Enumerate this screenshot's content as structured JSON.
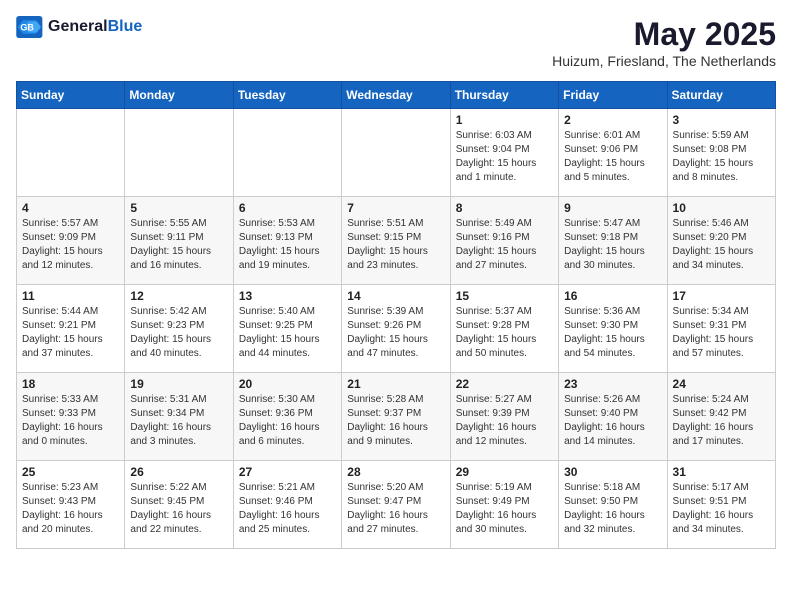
{
  "header": {
    "logo_general": "General",
    "logo_blue": "Blue",
    "month": "May 2025",
    "location": "Huizum, Friesland, The Netherlands"
  },
  "weekdays": [
    "Sunday",
    "Monday",
    "Tuesday",
    "Wednesday",
    "Thursday",
    "Friday",
    "Saturday"
  ],
  "weeks": [
    [
      {
        "day": "",
        "text": ""
      },
      {
        "day": "",
        "text": ""
      },
      {
        "day": "",
        "text": ""
      },
      {
        "day": "",
        "text": ""
      },
      {
        "day": "1",
        "text": "Sunrise: 6:03 AM\nSunset: 9:04 PM\nDaylight: 15 hours\nand 1 minute."
      },
      {
        "day": "2",
        "text": "Sunrise: 6:01 AM\nSunset: 9:06 PM\nDaylight: 15 hours\nand 5 minutes."
      },
      {
        "day": "3",
        "text": "Sunrise: 5:59 AM\nSunset: 9:08 PM\nDaylight: 15 hours\nand 8 minutes."
      }
    ],
    [
      {
        "day": "4",
        "text": "Sunrise: 5:57 AM\nSunset: 9:09 PM\nDaylight: 15 hours\nand 12 minutes."
      },
      {
        "day": "5",
        "text": "Sunrise: 5:55 AM\nSunset: 9:11 PM\nDaylight: 15 hours\nand 16 minutes."
      },
      {
        "day": "6",
        "text": "Sunrise: 5:53 AM\nSunset: 9:13 PM\nDaylight: 15 hours\nand 19 minutes."
      },
      {
        "day": "7",
        "text": "Sunrise: 5:51 AM\nSunset: 9:15 PM\nDaylight: 15 hours\nand 23 minutes."
      },
      {
        "day": "8",
        "text": "Sunrise: 5:49 AM\nSunset: 9:16 PM\nDaylight: 15 hours\nand 27 minutes."
      },
      {
        "day": "9",
        "text": "Sunrise: 5:47 AM\nSunset: 9:18 PM\nDaylight: 15 hours\nand 30 minutes."
      },
      {
        "day": "10",
        "text": "Sunrise: 5:46 AM\nSunset: 9:20 PM\nDaylight: 15 hours\nand 34 minutes."
      }
    ],
    [
      {
        "day": "11",
        "text": "Sunrise: 5:44 AM\nSunset: 9:21 PM\nDaylight: 15 hours\nand 37 minutes."
      },
      {
        "day": "12",
        "text": "Sunrise: 5:42 AM\nSunset: 9:23 PM\nDaylight: 15 hours\nand 40 minutes."
      },
      {
        "day": "13",
        "text": "Sunrise: 5:40 AM\nSunset: 9:25 PM\nDaylight: 15 hours\nand 44 minutes."
      },
      {
        "day": "14",
        "text": "Sunrise: 5:39 AM\nSunset: 9:26 PM\nDaylight: 15 hours\nand 47 minutes."
      },
      {
        "day": "15",
        "text": "Sunrise: 5:37 AM\nSunset: 9:28 PM\nDaylight: 15 hours\nand 50 minutes."
      },
      {
        "day": "16",
        "text": "Sunrise: 5:36 AM\nSunset: 9:30 PM\nDaylight: 15 hours\nand 54 minutes."
      },
      {
        "day": "17",
        "text": "Sunrise: 5:34 AM\nSunset: 9:31 PM\nDaylight: 15 hours\nand 57 minutes."
      }
    ],
    [
      {
        "day": "18",
        "text": "Sunrise: 5:33 AM\nSunset: 9:33 PM\nDaylight: 16 hours\nand 0 minutes."
      },
      {
        "day": "19",
        "text": "Sunrise: 5:31 AM\nSunset: 9:34 PM\nDaylight: 16 hours\nand 3 minutes."
      },
      {
        "day": "20",
        "text": "Sunrise: 5:30 AM\nSunset: 9:36 PM\nDaylight: 16 hours\nand 6 minutes."
      },
      {
        "day": "21",
        "text": "Sunrise: 5:28 AM\nSunset: 9:37 PM\nDaylight: 16 hours\nand 9 minutes."
      },
      {
        "day": "22",
        "text": "Sunrise: 5:27 AM\nSunset: 9:39 PM\nDaylight: 16 hours\nand 12 minutes."
      },
      {
        "day": "23",
        "text": "Sunrise: 5:26 AM\nSunset: 9:40 PM\nDaylight: 16 hours\nand 14 minutes."
      },
      {
        "day": "24",
        "text": "Sunrise: 5:24 AM\nSunset: 9:42 PM\nDaylight: 16 hours\nand 17 minutes."
      }
    ],
    [
      {
        "day": "25",
        "text": "Sunrise: 5:23 AM\nSunset: 9:43 PM\nDaylight: 16 hours\nand 20 minutes."
      },
      {
        "day": "26",
        "text": "Sunrise: 5:22 AM\nSunset: 9:45 PM\nDaylight: 16 hours\nand 22 minutes."
      },
      {
        "day": "27",
        "text": "Sunrise: 5:21 AM\nSunset: 9:46 PM\nDaylight: 16 hours\nand 25 minutes."
      },
      {
        "day": "28",
        "text": "Sunrise: 5:20 AM\nSunset: 9:47 PM\nDaylight: 16 hours\nand 27 minutes."
      },
      {
        "day": "29",
        "text": "Sunrise: 5:19 AM\nSunset: 9:49 PM\nDaylight: 16 hours\nand 30 minutes."
      },
      {
        "day": "30",
        "text": "Sunrise: 5:18 AM\nSunset: 9:50 PM\nDaylight: 16 hours\nand 32 minutes."
      },
      {
        "day": "31",
        "text": "Sunrise: 5:17 AM\nSunset: 9:51 PM\nDaylight: 16 hours\nand 34 minutes."
      }
    ]
  ]
}
